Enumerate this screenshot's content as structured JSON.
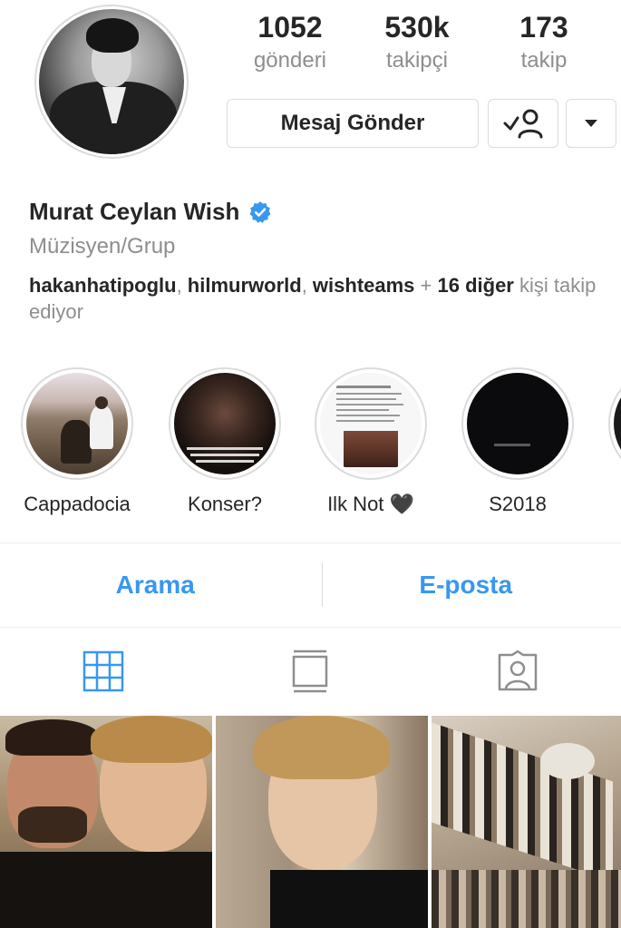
{
  "profile": {
    "name": "Murat Ceylan Wish",
    "category": "Müzisyen/Grup",
    "verified_icon": "verified-badge-icon"
  },
  "stats": [
    {
      "value": "1052",
      "label": "gönderi"
    },
    {
      "value": "530k",
      "label": "takipçi"
    },
    {
      "value": "173",
      "label": "takip"
    }
  ],
  "actions": {
    "message_label": "Mesaj Gönder",
    "follow_icon": "following-person-check-icon",
    "dropdown_icon": "caret-down-icon"
  },
  "followed_by": {
    "users": [
      "hakanhatipoglu",
      "hilmurworld",
      "wishteams"
    ],
    "sep1": ", ",
    "sep2": ", ",
    "plus": " + ",
    "others": "16 diğer",
    "suffix": " kişi takip ediyor"
  },
  "highlights": [
    {
      "label": "Cappadocia"
    },
    {
      "label": "Konser?"
    },
    {
      "label": "Ilk Not 🖤"
    },
    {
      "label": "S2018"
    }
  ],
  "contact": {
    "call_label": "Arama",
    "email_label": "E-posta"
  },
  "tabs": [
    {
      "icon": "grid-icon",
      "active": true
    },
    {
      "icon": "feed-list-icon",
      "active": false
    },
    {
      "icon": "tagged-person-icon",
      "active": false
    }
  ],
  "colors": {
    "accent": "#3897f0",
    "text": "#262626",
    "muted": "#8e8e8e",
    "border": "#dbdbdb"
  }
}
